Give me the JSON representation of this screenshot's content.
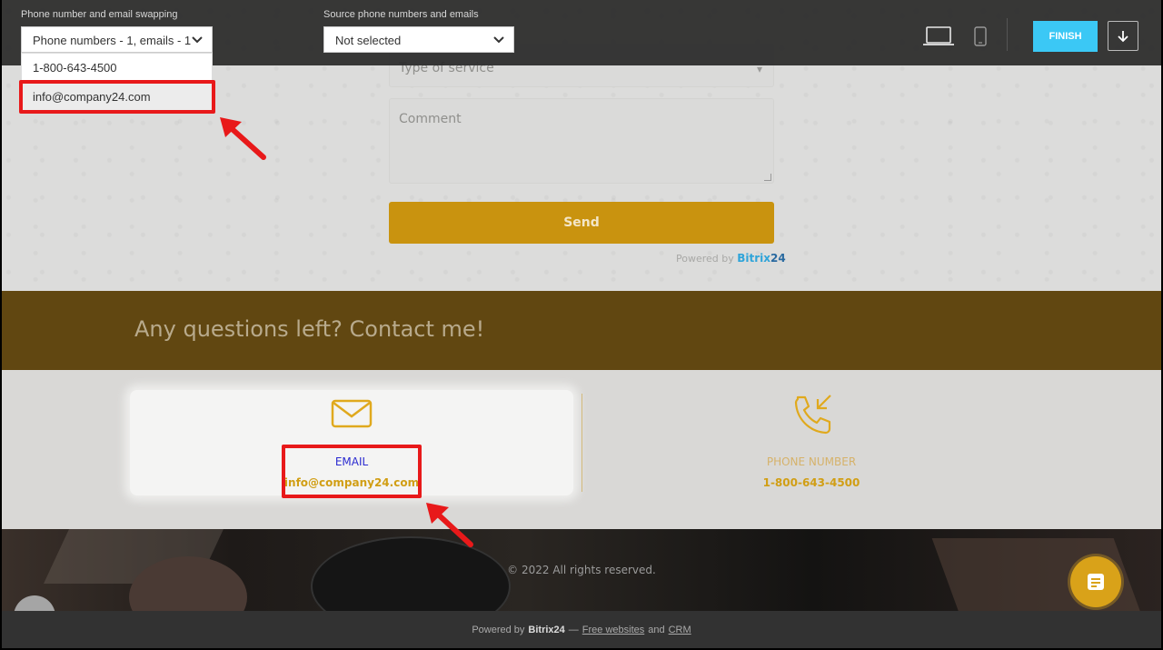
{
  "toolbar": {
    "swap_label": "Phone number and email swapping",
    "swap_value": "Phone numbers - 1, emails - 1",
    "source_label": "Source phone numbers and emails",
    "source_value": "Not selected",
    "dropdown_items": [
      "1-800-643-4500",
      "info@company24.com"
    ],
    "finish_label": "FINISH",
    "icons": [
      "laptop-icon",
      "phone-icon",
      "download-icon",
      "chevron-down-icon"
    ]
  },
  "form": {
    "type_placeholder": "Type of service",
    "comment_placeholder": "Comment",
    "send_label": "Send",
    "powered_prefix": "Powered by",
    "powered_brand": "Bitrix",
    "powered_brand_num": "24"
  },
  "banner": {
    "title": "Any questions left? Contact me!"
  },
  "contacts": {
    "email_label": "EMAIL",
    "email_value": "info@company24.com",
    "phone_label": "PHONE NUMBER",
    "phone_value": "1-800-643-4500",
    "colors": {
      "accent": "#d19e14",
      "email_label": "#2b2bd0",
      "highlight": "#e8191a"
    }
  },
  "footer": {
    "copyright": "© 2022 All rights reserved.",
    "powered_prefix": "Powered by",
    "brand": "Bitrix24",
    "dash": "—",
    "link1": "Free websites",
    "and": "and",
    "link2": "CRM"
  }
}
